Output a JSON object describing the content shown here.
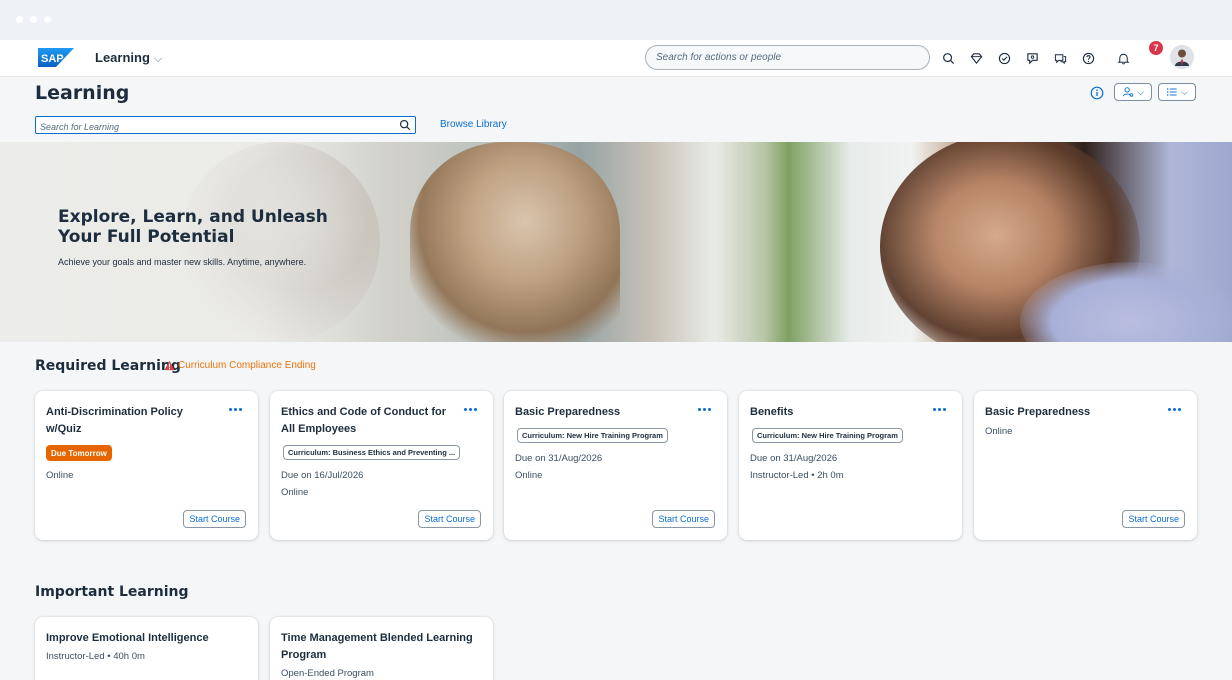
{
  "shell": {
    "app_title": "Learning",
    "search_placeholder": "Search for actions or people",
    "notification_count": "7"
  },
  "page": {
    "title": "Learning",
    "search_placeholder": "Search for Learning",
    "browse_label": "Browse Library"
  },
  "hero": {
    "title": "Explore, Learn, and Unleash Your Full Potential",
    "subtitle": "Achieve your goals and master new skills. Anytime, anywhere."
  },
  "required": {
    "title": "Required Learning",
    "warning": "Curriculum Compliance Ending",
    "start_label": "Start Course",
    "cards": [
      {
        "title": "Anti-Discrimination Policy w/Quiz",
        "badge": "Due Tomorrow",
        "delivery": "Online"
      },
      {
        "title": "Ethics and Code of Conduct for All Employees",
        "curriculum": "Curriculum: Business Ethics and Preventing ...",
        "due": "Due on 16/Jul/2026",
        "delivery": "Online"
      },
      {
        "title": "Basic Preparedness",
        "curriculum": "Curriculum: New Hire Training Program",
        "due": "Due on 31/Aug/2026",
        "delivery": "Online"
      },
      {
        "title": "Benefits",
        "curriculum": "Curriculum: New Hire Training Program",
        "due": "Due on 31/Aug/2026",
        "delivery": "Instructor-Led • 2h 0m"
      },
      {
        "title": "Basic Preparedness",
        "delivery": "Online"
      }
    ]
  },
  "important": {
    "title": "Important Learning",
    "cards": [
      {
        "title": "Improve Emotional Intelligence",
        "delivery": "Instructor-Led • 40h 0m"
      },
      {
        "title": "Time Management Blended Learning Program",
        "delivery": "Open-Ended Program"
      }
    ]
  },
  "colors": {
    "accent": "#0a6ed1",
    "warning": "#e9730c",
    "due_badge": "#e76500",
    "notification": "#d9364c"
  }
}
